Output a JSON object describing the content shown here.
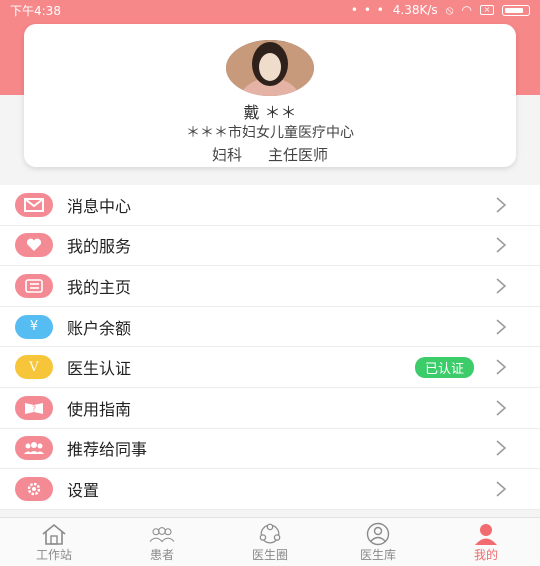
{
  "status_bar": {
    "time": "下午4:38",
    "dots": "• • •",
    "speed": "4.38K/s"
  },
  "profile": {
    "name": "戴 ＊＊",
    "hospital": "＊＊＊市妇女儿童医疗中心",
    "department": "妇科",
    "title": "主任医师"
  },
  "menu": [
    {
      "label": "消息中心",
      "icon": "mail-icon",
      "color": "#f48a94"
    },
    {
      "label": "我的服务",
      "icon": "heart-icon",
      "color": "#f48a94"
    },
    {
      "label": "我的主页",
      "icon": "list-icon",
      "color": "#f48a94"
    },
    {
      "label": "账户余额",
      "icon": "yen-icon",
      "color": "#56bdf2"
    },
    {
      "label": "医生认证",
      "icon": "verified-v-icon",
      "color": "#f6c53a",
      "badge": "已认证"
    },
    {
      "label": "使用指南",
      "icon": "guide-book-icon",
      "color": "#f48a94"
    },
    {
      "label": "推荐给同事",
      "icon": "group-icon",
      "color": "#f48a94"
    },
    {
      "label": "设置",
      "icon": "gear-icon",
      "color": "#f48a94"
    }
  ],
  "icon_glyphs": {
    "yen": "¥",
    "v": "V",
    "q": "?"
  },
  "tabs": [
    {
      "label": "工作站",
      "icon": "home-icon"
    },
    {
      "label": "患者",
      "icon": "patients-icon"
    },
    {
      "label": "医生圈",
      "icon": "doctor-circle-icon"
    },
    {
      "label": "医生库",
      "icon": "doctor-library-icon"
    },
    {
      "label": "我的",
      "icon": "profile-icon",
      "active": true
    }
  ],
  "colors": {
    "accent": "#f26b6e",
    "header": "#f7888a",
    "badge": "#3dcc6a"
  }
}
